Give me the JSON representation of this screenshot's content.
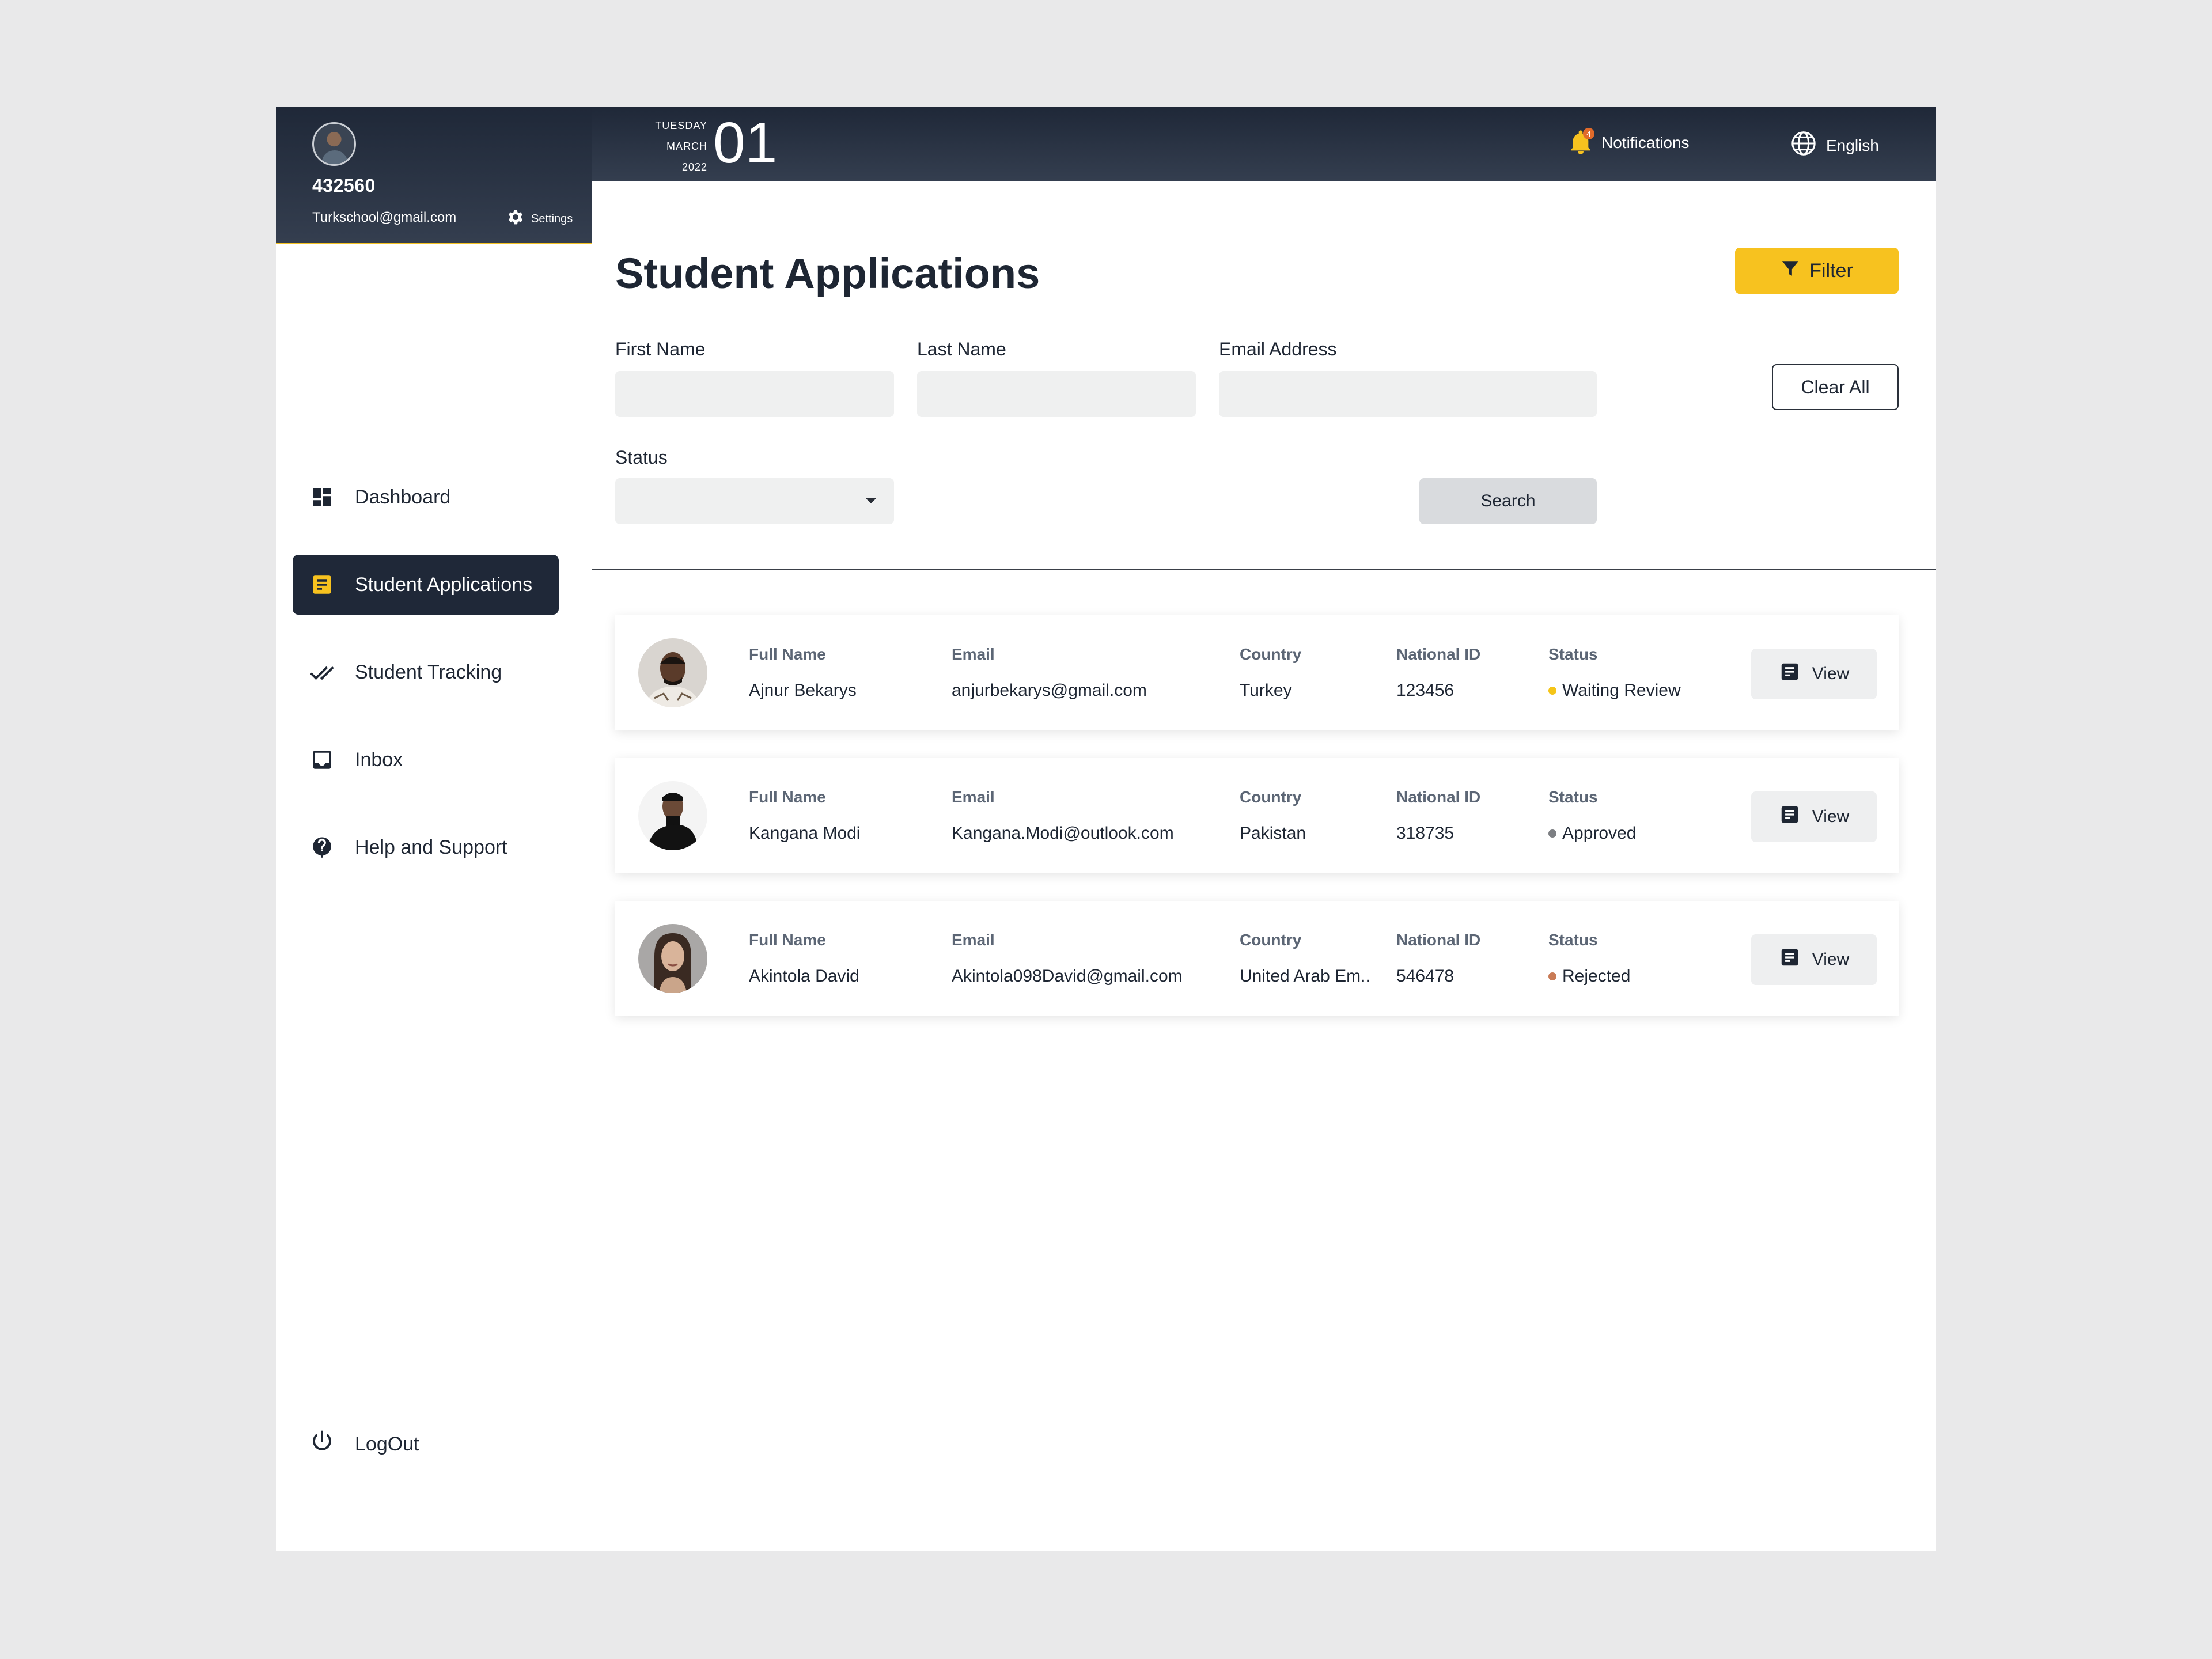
{
  "profile": {
    "user_id": "432560",
    "email": "Turkschool@gmail.com",
    "settings_label": "Settings"
  },
  "topbar": {
    "day_name": "TUESDAY",
    "month": "MARCH",
    "year": "2022",
    "day_number": "01",
    "notifications_label": "Notifications",
    "notifications_count": "4",
    "language_label": "English"
  },
  "nav": {
    "items": [
      {
        "label": "Dashboard",
        "icon": "dashboard-icon"
      },
      {
        "label": "Student Applications",
        "icon": "applications-icon"
      },
      {
        "label": "Student Tracking",
        "icon": "double-check-icon"
      },
      {
        "label": "Inbox",
        "icon": "inbox-icon"
      },
      {
        "label": "Help and Support",
        "icon": "help-icon"
      }
    ],
    "active_index": 1,
    "logout_label": "LogOut"
  },
  "main": {
    "title": "Student Applications",
    "filter_label": "Filter",
    "clear_label": "Clear All",
    "search_label": "Search",
    "fields": {
      "first_name": {
        "label": "First Name",
        "value": ""
      },
      "last_name": {
        "label": "Last Name",
        "value": ""
      },
      "email": {
        "label": "Email Address",
        "value": ""
      },
      "status": {
        "label": "Status",
        "value": ""
      }
    }
  },
  "columns": {
    "full_name": "Full Name",
    "email": "Email",
    "country": "Country",
    "national_id": "National ID",
    "status": "Status"
  },
  "view_label": "View",
  "applicants": [
    {
      "name": "Ajnur Bekarys",
      "email": "anjurbekarys@gmail.com",
      "country": "Turkey",
      "national_id": "123456",
      "status": "Waiting Review",
      "status_color": "#f5c518"
    },
    {
      "name": "Kangana Modi",
      "email": "Kangana.Modi@outlook.com",
      "country": "Pakistan",
      "national_id": "318735",
      "status": "Approved",
      "status_color": "#7d7f83"
    },
    {
      "name": "Akintola David",
      "email": "Akintola098David@gmail.com",
      "country": "United Arab Em..",
      "national_id": "546478",
      "status": "Rejected",
      "status_color": "#c97b56"
    }
  ],
  "colors": {
    "dark": "#1f2838",
    "accent": "#f7c21f"
  }
}
